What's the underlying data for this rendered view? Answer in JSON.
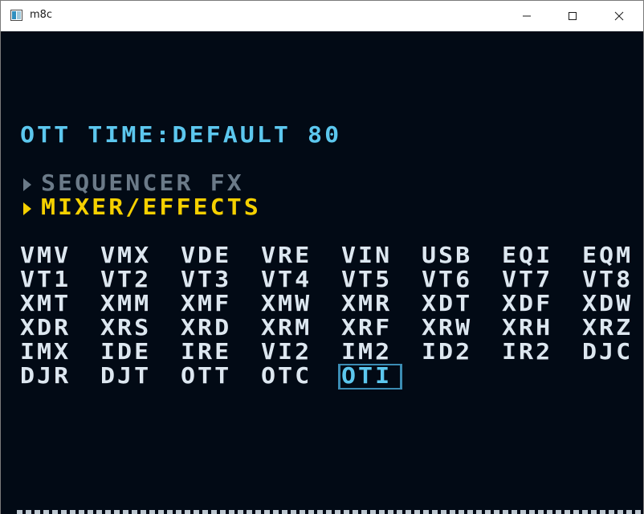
{
  "window": {
    "title": "m8c"
  },
  "screen": {
    "header": "OTT TIME:DEFAULT 80",
    "menu": [
      {
        "label": "SEQUENCER FX",
        "state": "inactive",
        "color": "#6b7a88"
      },
      {
        "label": "MIXER/EFFECTS",
        "state": "active",
        "color": "#f5d000"
      }
    ],
    "grid": [
      [
        "VMV",
        "VMX",
        "VDE",
        "VRE",
        "VIN",
        "USB",
        "EQI",
        "EQM"
      ],
      [
        "VT1",
        "VT2",
        "VT3",
        "VT4",
        "VT5",
        "VT6",
        "VT7",
        "VT8"
      ],
      [
        "XMT",
        "XMM",
        "XMF",
        "XMW",
        "XMR",
        "XDT",
        "XDF",
        "XDW"
      ],
      [
        "XDR",
        "XRS",
        "XRD",
        "XRM",
        "XRF",
        "XRW",
        "XRH",
        "XRZ"
      ],
      [
        "IMX",
        "IDE",
        "IRE",
        "VI2",
        "IM2",
        "ID2",
        "IR2",
        "DJC"
      ],
      [
        "DJR",
        "DJT",
        "OTT",
        "OTC",
        "OTI"
      ]
    ],
    "selected": "OTI",
    "colors": {
      "background": "#020a15",
      "header": "#5cc7ee",
      "text": "#dde7f0",
      "selected": "#5cc7ee",
      "highlight": "#f5d000",
      "dim": "#6b7a88"
    }
  }
}
